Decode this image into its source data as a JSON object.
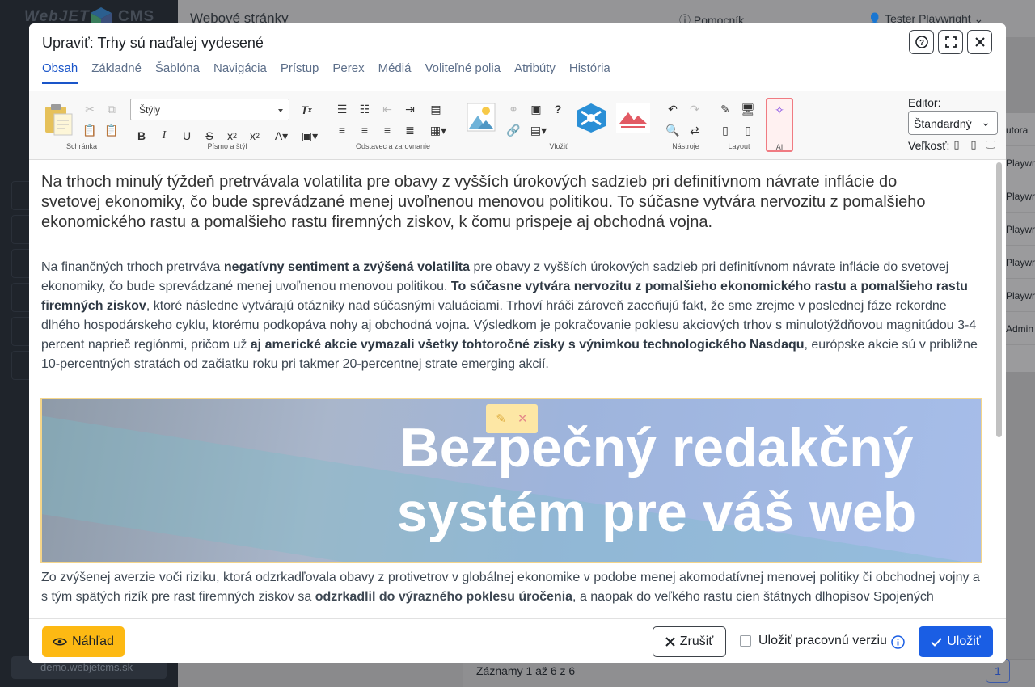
{
  "app": {
    "logo_text": "WebJET",
    "logo_cms": "CMS",
    "page_title": "Webové stránky",
    "help_label": "Pomocník",
    "user_name": "Tester Playwright",
    "domain": "demo.webjetcms.sk"
  },
  "background_table": {
    "header_partial": "utora",
    "rows": [
      "Playwrig",
      "Playwrig",
      "Playwrig",
      "Playwrig",
      "Playwrig",
      "Admin"
    ],
    "records_text": "Záznamy 1 až 6 z 6",
    "page_number": "1"
  },
  "modal": {
    "title": "Upraviť: Trhy sú naďalej vydesené",
    "tabs": [
      "Obsah",
      "Základné",
      "Šablóna",
      "Navigácia",
      "Prístup",
      "Perex",
      "Médiá",
      "Voliteľné polia",
      "Atribúty",
      "História"
    ],
    "active_tab": "Obsah"
  },
  "toolbar": {
    "styles_value": "Štýly",
    "groups": {
      "clipboard": "Schránka",
      "font": "Písmo a štýl",
      "paragraph": "Odstavec a zarovnanie",
      "insert": "Vložiť",
      "tools": "Nástroje",
      "layout": "Layout",
      "ai": "AI"
    },
    "editor_label": "Editor:",
    "editor_value": "Štandardný",
    "size_label": "Veľkosť:"
  },
  "content": {
    "lead": "Na trhoch minulý týždeň pretrvávala volatilita pre obavy z vyšších úrokových sadzieb pri definitívnom návrate inflácie do svetovej ekonomiky, čo bude sprevádzané menej uvoľnenou menovou politikou. To súčasne vytvára nervozitu z pomalšieho ekonomického rastu a pomalšieho rastu firemných ziskov, k čomu prispeje aj obchodná vojna.",
    "p1_a": "Na finančných trhoch pretrváva ",
    "p1_b": "negatívny sentiment a zvýšená volatilita",
    "p1_c": " pre obavy z vyšších úrokových sadzieb pri definitívnom návrate inflácie do svetovej ekonomiky, čo bude sprevádzané menej uvoľnenou menovou politikou. ",
    "p1_d": "To súčasne vytvára nervozitu z pomalšieho ekonomického rastu a pomalšieho rastu firemných ziskov",
    "p1_e": ", ktoré následne vytvárajú otázniky nad súčasnými valuáciami. Trhoví hráči zároveň zaceňujú fakt, že sme zrejme v poslednej fáze rekordne dlhého hospodárskeho cyklu, ktorému podkopáva nohy aj obchodná vojna. Výsledkom je pokračovanie poklesu akciových trhov s minulotýždňovou magnitúdou 3-4 percent naprieč regiónmi, pričom už ",
    "p1_f": "aj americké akcie vymazali všetky tohtoročné zisky s výnimkou technologického Nasdaqu",
    "p1_g": ", európske akcie sú v približne 10-percentných stratách od začiatku roku pri takmer 20-percentnej strate emerging akcií.",
    "banner_line1": "Bezpečný redakčný",
    "banner_line2": "systém pre váš web",
    "p2_a": "Zo zvýšenej averzie voči riziku, ktorá odzrkadľovala obavy z protivetrov v globálnej ekonomike v podobe menej akomodatívnej menovej politiky či obchodnej vojny a s tým spätých rizík pre rast firemných ziskov sa ",
    "p2_b": "odzrkadlil do výrazného poklesu úročenia",
    "p2_c": ", a naopak do veľkého rastu cien štátnych dlhopisov Spojených"
  },
  "footer": {
    "preview": "Náhľad",
    "cancel": "Zrušiť",
    "draft": "Uložiť pracovnú verziu",
    "save": "Uložiť"
  },
  "colors": {
    "primary": "#1a5ee4",
    "preview_btn": "#fdb913",
    "ai_highlight": "#f07b82"
  }
}
